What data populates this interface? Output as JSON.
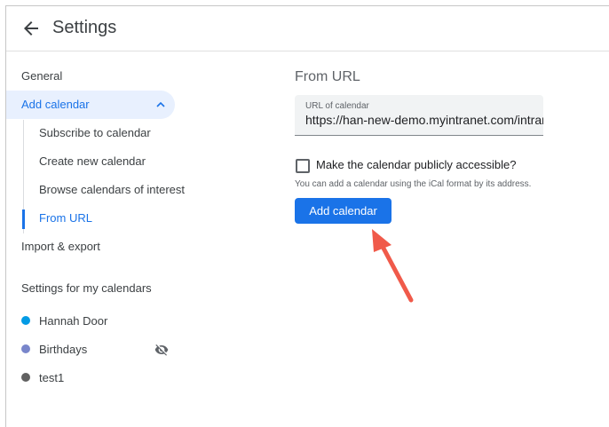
{
  "header": {
    "title": "Settings"
  },
  "sidebar": {
    "general": "General",
    "add_calendar": "Add calendar",
    "sub_items": [
      "Subscribe to calendar",
      "Create new calendar",
      "Browse calendars of interest",
      "From URL"
    ],
    "import_export": "Import & export",
    "section_heading": "Settings for my calendars",
    "calendars": [
      {
        "name": "Hannah Door",
        "color": "#039be5"
      },
      {
        "name": "Birthdays",
        "color": "#7986cb"
      },
      {
        "name": "test1",
        "color": "#616161"
      }
    ]
  },
  "main": {
    "title": "From URL",
    "url_label": "URL of calendar",
    "url_value": "https://han-new-demo.myintranet.com/intrar",
    "checkbox_label": "Make the calendar publicly accessible?",
    "helper_text": "You can add a calendar using the iCal format by its address.",
    "add_button": "Add calendar"
  },
  "colors": {
    "accent": "#1a73e8",
    "annotation_arrow": "#f05a4a"
  }
}
